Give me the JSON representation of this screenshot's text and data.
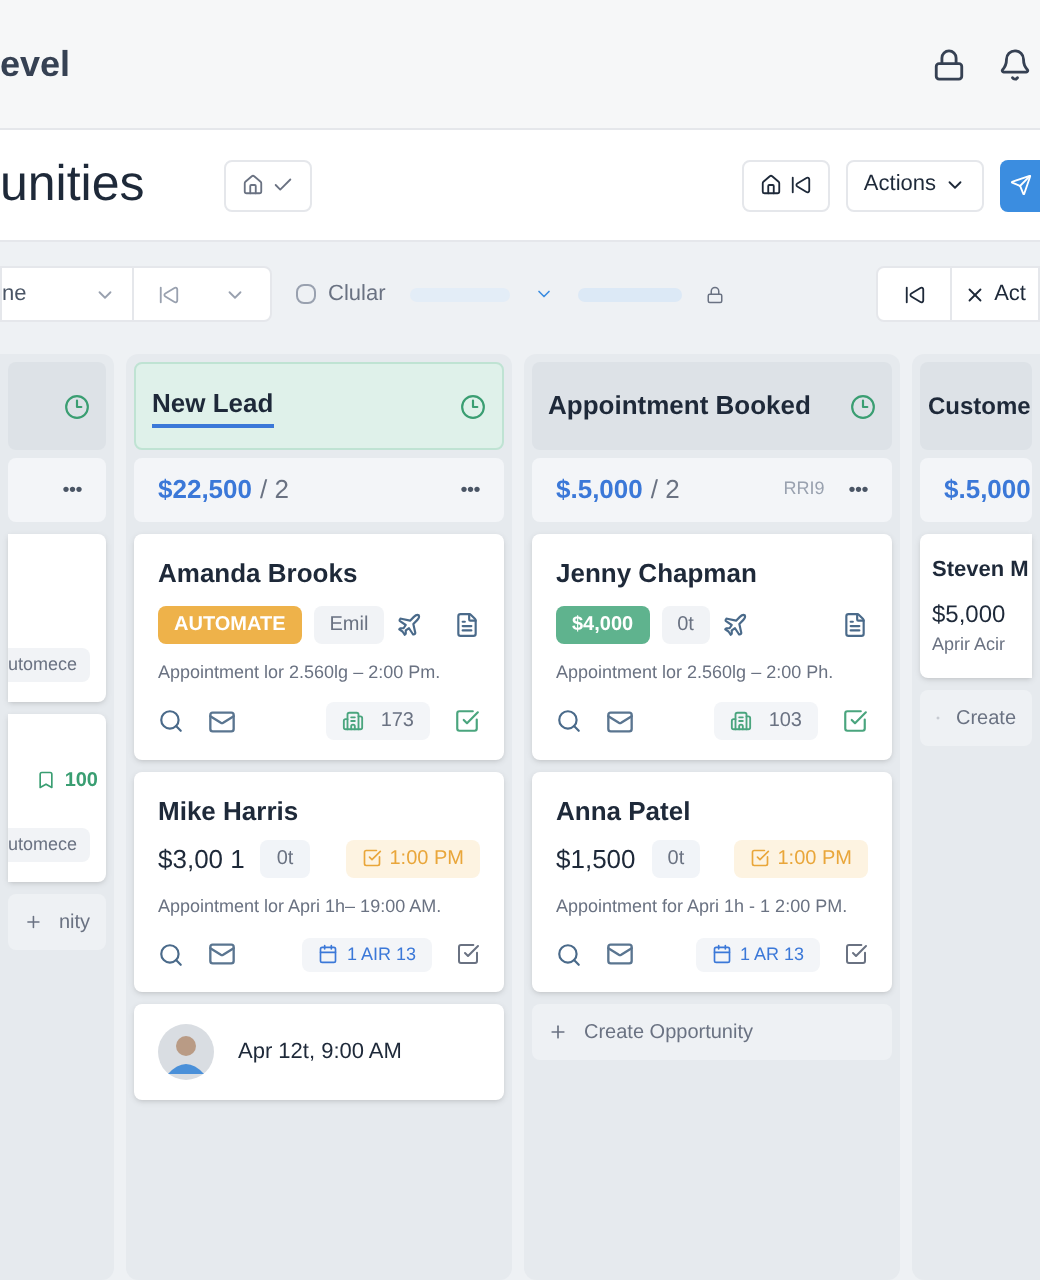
{
  "app_bar": {
    "brand": "evel"
  },
  "page_header": {
    "title": "unities",
    "actions_label": "Actions",
    "home_view": {
      "checked": true
    }
  },
  "filters": {
    "select_value": "ne",
    "checkbox": {
      "label": "Clular",
      "checked": false
    },
    "right_button": "Act"
  },
  "columns": [
    {
      "kind": "partial_left",
      "highlighted": false,
      "summary": {
        "menu": "•••"
      },
      "cards": [
        {
          "kind": "stub",
          "tag": "utomece"
        },
        {
          "kind": "stub",
          "count": "100",
          "tag": "utomece"
        }
      ],
      "create": "nity"
    },
    {
      "kind": "full",
      "title": "New Lead",
      "highlighted": true,
      "summary": {
        "amount": "$22,500",
        "count": "/ 2",
        "menu": "•••"
      },
      "cards": [
        {
          "kind": "deal",
          "name": "Amanda Brooks",
          "badges": [
            {
              "kind": "status",
              "text": "AUTOMATE"
            },
            {
              "kind": "chip",
              "text": "Emil"
            }
          ],
          "note": "Appointment lor 2.560lg – 2:00 Pm.",
          "count": "173"
        },
        {
          "kind": "timed",
          "name": "Mike Harris",
          "amount": "$3,00 1",
          "chip": "0t",
          "time": "1:00 PM",
          "note": "Appointment lor Apri 1h– 19:00 AM.",
          "date": "1 AIR 13"
        },
        {
          "kind": "contact",
          "text": "Apr 12t, 9:00 AM"
        }
      ]
    },
    {
      "kind": "full",
      "title": "Appointment Booked",
      "highlighted": false,
      "summary": {
        "amount": "$.5,000",
        "count": "/ 2",
        "code": "RRI9",
        "menu": "•••"
      },
      "cards": [
        {
          "kind": "deal",
          "name": "Jenny Chapman",
          "badges": [
            {
              "kind": "amount",
              "text": "$4,000"
            },
            {
              "kind": "chip",
              "text": "0t"
            }
          ],
          "note": "Appointment lor 2.560lg – 2:00 Ph.",
          "count": "103"
        },
        {
          "kind": "timed",
          "name": "Anna Patel",
          "amount": "$1,500",
          "chip": "0t",
          "time": "1:00 PM",
          "note": "Appointment for Apri 1h - 1 2:00 PM.",
          "date": "1 AR 13"
        }
      ],
      "create": "Create Opportunity"
    },
    {
      "kind": "partial_right",
      "title": "Custome",
      "highlighted": false,
      "summary": {
        "amount": "$.5,000"
      },
      "cards": [
        {
          "kind": "brief",
          "name": "Steven M",
          "amount": "$5,000",
          "note": "Aprir Acir"
        }
      ],
      "create": "Create"
    }
  ]
}
